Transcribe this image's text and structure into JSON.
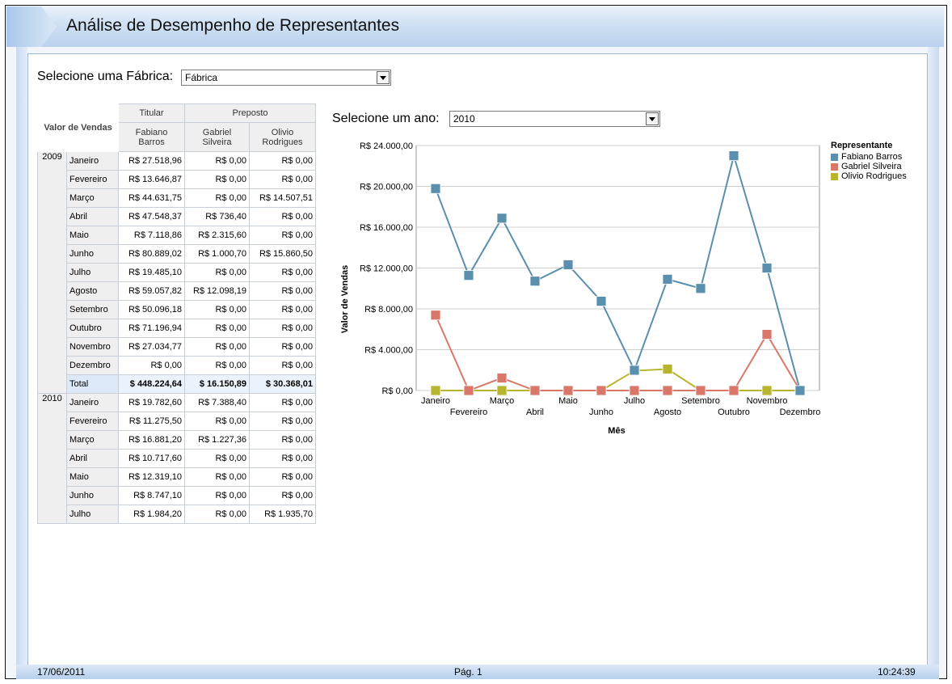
{
  "title": "Análise de Desempenho de Representantes",
  "factory_select": {
    "label": "Selecione uma Fábrica:",
    "value": "Fábrica"
  },
  "year_select": {
    "label": "Selecione um ano:",
    "value": "2010"
  },
  "table": {
    "corner_label": "Valor de Vendas",
    "group_headers": [
      "Titular",
      "Preposto"
    ],
    "columns": [
      "Fabiano Barros",
      "Gabriel Silveira",
      "Olivio Rodrigues"
    ],
    "groups": [
      {
        "year": "2009",
        "rows": [
          {
            "month": "Janeiro",
            "values": [
              "R$ 27.518,96",
              "R$ 0,00",
              "R$ 0,00"
            ]
          },
          {
            "month": "Fevereiro",
            "values": [
              "R$ 13.646,87",
              "R$ 0,00",
              "R$ 0,00"
            ]
          },
          {
            "month": "Março",
            "values": [
              "R$ 44.631,75",
              "R$ 0,00",
              "R$ 14.507,51"
            ]
          },
          {
            "month": "Abril",
            "values": [
              "R$ 47.548,37",
              "R$ 736,40",
              "R$ 0,00"
            ]
          },
          {
            "month": "Maio",
            "values": [
              "R$ 7.118,86",
              "R$ 2.315,60",
              "R$ 0,00"
            ]
          },
          {
            "month": "Junho",
            "values": [
              "R$ 80.889,02",
              "R$ 1.000,70",
              "R$ 15.860,50"
            ]
          },
          {
            "month": "Julho",
            "values": [
              "R$ 19.485,10",
              "R$ 0,00",
              "R$ 0,00"
            ]
          },
          {
            "month": "Agosto",
            "values": [
              "R$ 59.057,82",
              "R$ 12.098,19",
              "R$ 0,00"
            ]
          },
          {
            "month": "Setembro",
            "values": [
              "R$ 50.096,18",
              "R$ 0,00",
              "R$ 0,00"
            ]
          },
          {
            "month": "Outubro",
            "values": [
              "R$ 71.196,94",
              "R$ 0,00",
              "R$ 0,00"
            ]
          },
          {
            "month": "Novembro",
            "values": [
              "R$ 27.034,77",
              "R$ 0,00",
              "R$ 0,00"
            ]
          },
          {
            "month": "Dezembro",
            "values": [
              "R$ 0,00",
              "R$ 0,00",
              "R$ 0,00"
            ]
          },
          {
            "month": "Total",
            "values": [
              "$ 448.224,64",
              "$ 16.150,89",
              "$ 30.368,01"
            ],
            "total": true
          }
        ]
      },
      {
        "year": "2010",
        "rows": [
          {
            "month": "Janeiro",
            "values": [
              "R$ 19.782,60",
              "R$ 7.388,40",
              "R$ 0,00"
            ]
          },
          {
            "month": "Fevereiro",
            "values": [
              "R$ 11.275,50",
              "R$ 0,00",
              "R$ 0,00"
            ]
          },
          {
            "month": "Março",
            "values": [
              "R$ 16.881,20",
              "R$ 1.227,36",
              "R$ 0,00"
            ]
          },
          {
            "month": "Abril",
            "values": [
              "R$ 10.717,60",
              "R$ 0,00",
              "R$ 0,00"
            ]
          },
          {
            "month": "Maio",
            "values": [
              "R$ 12.319,10",
              "R$ 0,00",
              "R$ 0,00"
            ]
          },
          {
            "month": "Junho",
            "values": [
              "R$ 8.747,10",
              "R$ 0,00",
              "R$ 0,00"
            ]
          },
          {
            "month": "Julho",
            "values": [
              "R$ 1.984,20",
              "R$ 0,00",
              "R$ 1.935,70"
            ]
          }
        ]
      }
    ]
  },
  "chart_data": {
    "type": "line",
    "title": "",
    "xlabel": "Mês",
    "ylabel": "Valor de Vendas",
    "categories": [
      "Janeiro",
      "Fevereiro",
      "Março",
      "Abril",
      "Maio",
      "Junho",
      "Julho",
      "Agosto",
      "Setembro",
      "Outubro",
      "Novembro",
      "Dezembro"
    ],
    "y_ticks": [
      "R$ 0,00",
      "R$ 4.000,00",
      "R$ 8.000,00",
      "R$ 12.000,00",
      "R$ 16.000,00",
      "R$ 20.000,00",
      "R$ 24.000,00"
    ],
    "ylim": [
      0,
      24000
    ],
    "grid": true,
    "legend_title": "Representante",
    "legend_position": "top-right",
    "series": [
      {
        "name": "Fabiano Barros",
        "color": "#5b8fae",
        "values": [
          19782.6,
          11275.5,
          16881.2,
          10717.6,
          12319.1,
          8747.1,
          1984.2,
          10900,
          10000,
          23000,
          12000,
          0
        ]
      },
      {
        "name": "Gabriel Silveira",
        "color": "#d9786a",
        "values": [
          7388.4,
          0,
          1227.36,
          0,
          0,
          0,
          0,
          0,
          0,
          0,
          5500,
          0
        ]
      },
      {
        "name": "Olivio Rodrigues",
        "color": "#b7b52e",
        "values": [
          0,
          0,
          0,
          0,
          0,
          0,
          1935.7,
          2100,
          0,
          0,
          0,
          0
        ]
      }
    ]
  },
  "footer": {
    "date": "17/06/2011",
    "page": "Pág. 1",
    "time": "10:24:39"
  }
}
